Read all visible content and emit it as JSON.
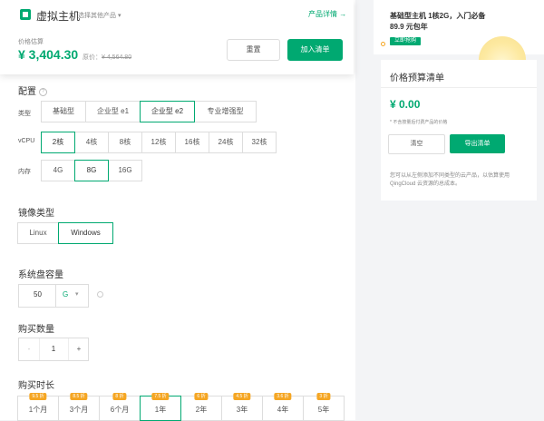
{
  "colors": {
    "accent": "#00a971",
    "discount": "#f5a623"
  },
  "header": {
    "title": "虚拟主机",
    "select_other": "选择其他产品",
    "detail_link": "产品详情 →",
    "price_label": "价格估算",
    "price": "¥ 3,404.30",
    "orig_prefix": "原价：",
    "orig_price": "¥ 4,564.80",
    "reset_label": "重置",
    "add_label": "加入清单"
  },
  "config": {
    "title": "配置",
    "type_label": "类型",
    "types": [
      "基础型",
      "企业型 e1",
      "企业型 e2",
      "专业增强型"
    ],
    "type_selected": "企业型 e2",
    "vcpu_label": "vCPU",
    "vcpus": [
      "2核",
      "4核",
      "8核",
      "12核",
      "16核",
      "24核",
      "32核"
    ],
    "vcpu_selected": "2核",
    "mem_label": "内存",
    "mems": [
      "4G",
      "8G",
      "16G"
    ],
    "mem_selected": "8G"
  },
  "image": {
    "title": "镜像类型",
    "options": [
      "Linux",
      "Windows"
    ],
    "selected": "Windows"
  },
  "disk": {
    "title": "系统盘容量",
    "value": "50",
    "unit": "G"
  },
  "quantity": {
    "title": "购买数量",
    "minus": "-",
    "value": "1",
    "plus": "+"
  },
  "duration": {
    "title": "购买时长",
    "options": [
      {
        "label": "1个月",
        "discount": "9.5 折"
      },
      {
        "label": "3个月",
        "discount": "8.5 折"
      },
      {
        "label": "6个月",
        "discount": "8 折"
      },
      {
        "label": "1年",
        "discount": "7.5 折"
      },
      {
        "label": "2年",
        "discount": "6 折"
      },
      {
        "label": "3年",
        "discount": "4.5 折"
      },
      {
        "label": "4年",
        "discount": "3.6 折"
      },
      {
        "label": "5年",
        "discount": "3 折"
      }
    ],
    "selected": "1年"
  },
  "promo": {
    "title": "基础型主机 1核2G，入门必备",
    "price": "89.9 元包年",
    "button": "立即抢购"
  },
  "budget": {
    "title": "价格预算清单",
    "amount": "¥ 0.00",
    "note": "* 不含按量后付费产品的价格",
    "clear_label": "清空",
    "export_label": "导出清单",
    "description": "您可以从左侧添加不同类型的云产品，以估算使用 QingCloud 云资源的总成本。"
  }
}
